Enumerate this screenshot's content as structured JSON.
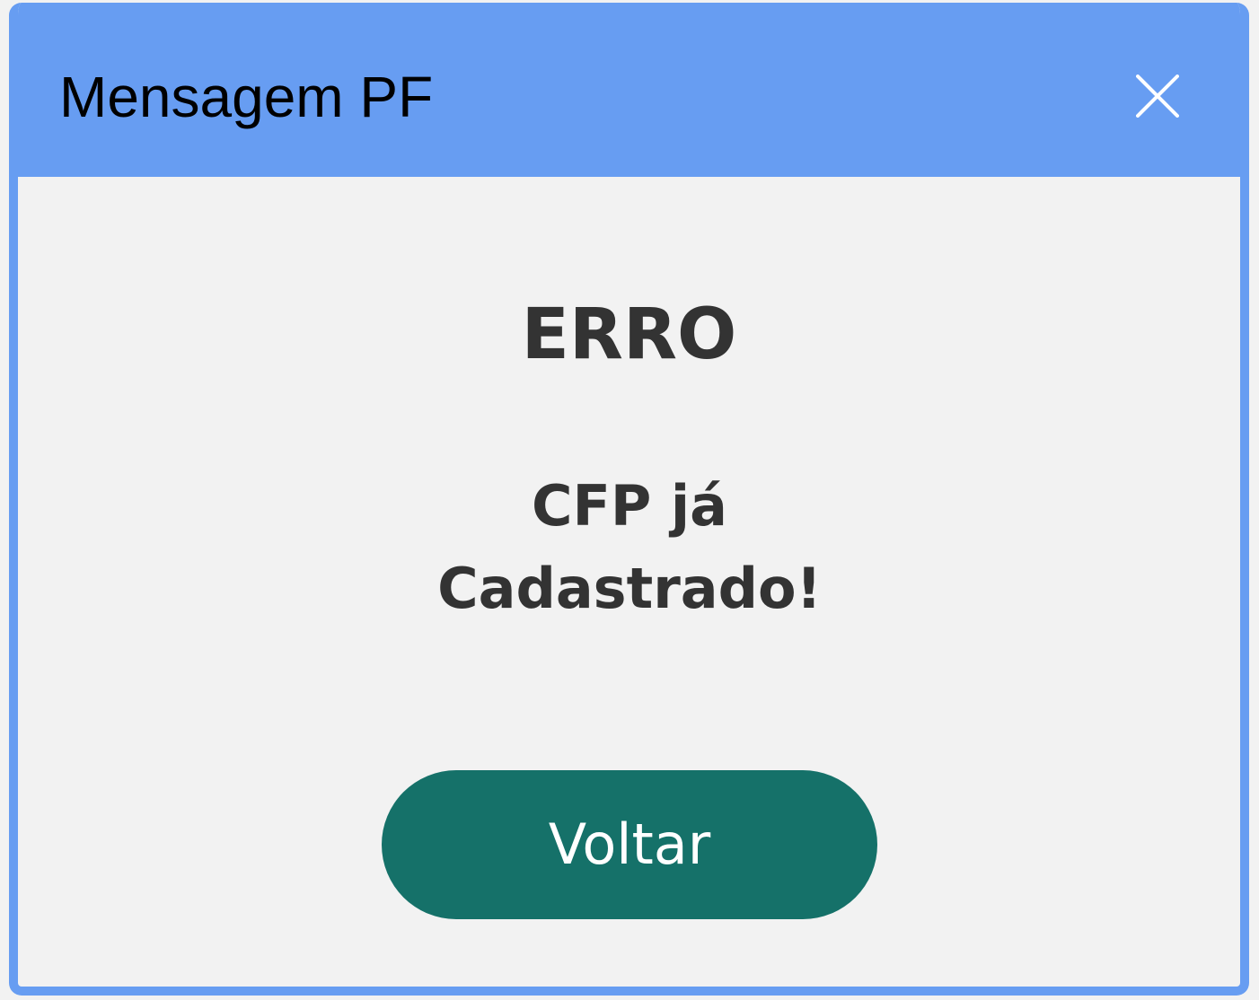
{
  "dialog": {
    "title": "Mensagem PF",
    "close_icon": "close-icon",
    "heading": "ERRO",
    "message": "CFP já Cadastrado!",
    "back_button_label": "Voltar"
  },
  "colors": {
    "titlebar": "#679df2",
    "border": "#679df2",
    "body_background": "#f2f2f2",
    "text": "#333333",
    "button": "#157169",
    "button_text": "#ffffff"
  }
}
